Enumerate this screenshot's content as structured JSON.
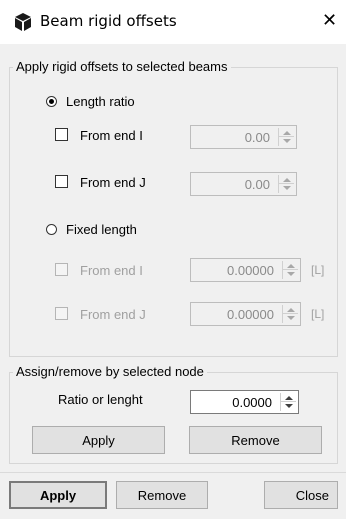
{
  "window": {
    "title": "Beam rigid offsets",
    "close_glyph": "✕",
    "title_icon": "cube-icon"
  },
  "group_offsets": {
    "legend": "Apply rigid offsets to selected beams",
    "length_ratio": {
      "label": "Length ratio",
      "selected": true,
      "from_end_i": {
        "label": "From end I",
        "checked": false,
        "value": "0.00"
      },
      "from_end_j": {
        "label": "From end J",
        "checked": false,
        "value": "0.00"
      }
    },
    "fixed_length": {
      "label": "Fixed length",
      "selected": false,
      "from_end_i": {
        "label": "From end I",
        "checked": false,
        "value": "0.00000",
        "unit": "[L]",
        "enabled": false
      },
      "from_end_j": {
        "label": "From end J",
        "checked": false,
        "value": "0.00000",
        "unit": "[L]",
        "enabled": false
      }
    }
  },
  "group_node": {
    "legend": "Assign/remove by selected node",
    "ratio_label": "Ratio or lenght",
    "ratio_value": "0.0000",
    "apply_label": "Apply",
    "remove_label": "Remove"
  },
  "footer": {
    "apply_label": "Apply",
    "remove_label": "Remove",
    "close_label": "Close"
  }
}
